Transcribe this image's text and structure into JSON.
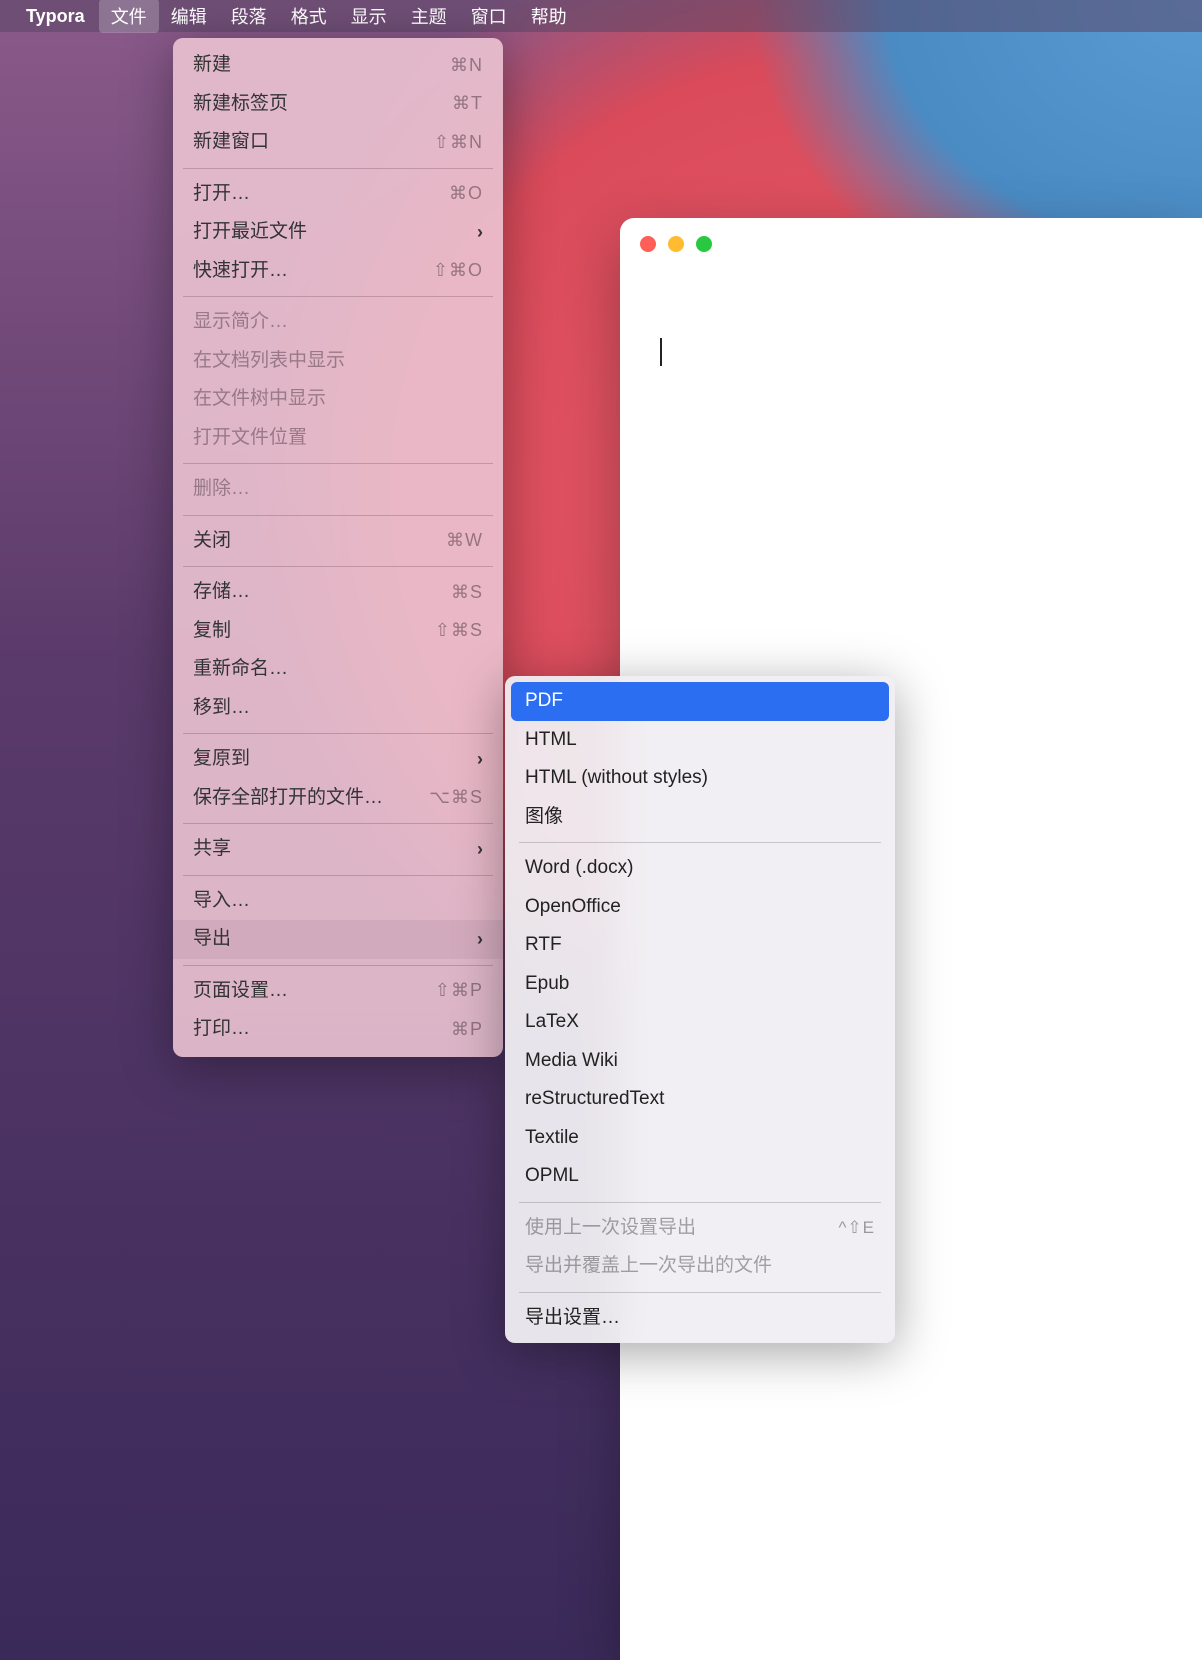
{
  "menubar": {
    "appname": "Typora",
    "items": [
      "文件",
      "编辑",
      "段落",
      "格式",
      "显示",
      "主题",
      "窗口",
      "帮助"
    ],
    "activeIndex": 0
  },
  "fileMenu": {
    "groups": [
      [
        {
          "label": "新建",
          "shortcut": "⌘N"
        },
        {
          "label": "新建标签页",
          "shortcut": "⌘T"
        },
        {
          "label": "新建窗口",
          "shortcut": "⇧⌘N"
        }
      ],
      [
        {
          "label": "打开…",
          "shortcut": "⌘O"
        },
        {
          "label": "打开最近文件",
          "submenu": true
        },
        {
          "label": "快速打开…",
          "shortcut": "⇧⌘O"
        }
      ],
      [
        {
          "label": "显示简介…",
          "disabled": true
        },
        {
          "label": "在文档列表中显示",
          "disabled": true
        },
        {
          "label": "在文件树中显示",
          "disabled": true
        },
        {
          "label": "打开文件位置",
          "disabled": true
        }
      ],
      [
        {
          "label": "删除…",
          "disabled": true
        }
      ],
      [
        {
          "label": "关闭",
          "shortcut": "⌘W"
        }
      ],
      [
        {
          "label": "存储…",
          "shortcut": "⌘S"
        },
        {
          "label": "复制",
          "shortcut": "⇧⌘S"
        },
        {
          "label": "重新命名…"
        },
        {
          "label": "移到…"
        }
      ],
      [
        {
          "label": "复原到",
          "submenu": true
        },
        {
          "label": "保存全部打开的文件…",
          "shortcut": "⌥⌘S"
        }
      ],
      [
        {
          "label": "共享",
          "submenu": true
        }
      ],
      [
        {
          "label": "导入…"
        },
        {
          "label": "导出",
          "submenu": true,
          "hover": true
        }
      ],
      [
        {
          "label": "页面设置…",
          "shortcut": "⇧⌘P"
        },
        {
          "label": "打印…",
          "shortcut": "⌘P"
        }
      ]
    ]
  },
  "exportMenu": {
    "groups": [
      [
        {
          "label": "PDF",
          "selected": true
        },
        {
          "label": "HTML"
        },
        {
          "label": "HTML (without styles)"
        },
        {
          "label": "图像"
        }
      ],
      [
        {
          "label": "Word (.docx)"
        },
        {
          "label": "OpenOffice"
        },
        {
          "label": "RTF"
        },
        {
          "label": "Epub"
        },
        {
          "label": "LaTeX"
        },
        {
          "label": "Media Wiki"
        },
        {
          "label": "reStructuredText"
        },
        {
          "label": "Textile"
        },
        {
          "label": "OPML"
        }
      ],
      [
        {
          "label": "使用上一次设置导出",
          "shortcut": "^⇧E",
          "disabled": true
        },
        {
          "label": "导出并覆盖上一次导出的文件",
          "disabled": true
        }
      ],
      [
        {
          "label": "导出设置…"
        }
      ]
    ]
  }
}
